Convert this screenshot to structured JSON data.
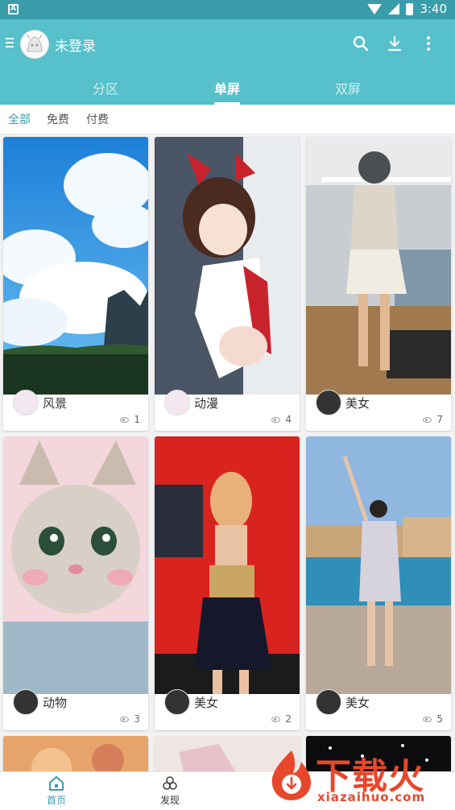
{
  "status_bar": {
    "time": "3:40"
  },
  "app_bar": {
    "title": "未登录",
    "icons": [
      "menu-icon",
      "search-icon",
      "download-icon",
      "more-vert-icon"
    ]
  },
  "tabs": [
    {
      "label": "分区",
      "active": false
    },
    {
      "label": "单屏",
      "active": true
    },
    {
      "label": "双屏",
      "active": false
    }
  ],
  "filters": [
    {
      "label": "全部",
      "active": true
    },
    {
      "label": "免费",
      "active": false
    },
    {
      "label": "付费",
      "active": false
    }
  ],
  "cards": [
    {
      "label": "风景",
      "views": "1"
    },
    {
      "label": "动漫",
      "views": "4"
    },
    {
      "label": "美女",
      "views": "7"
    },
    {
      "label": "动物",
      "views": "3"
    },
    {
      "label": "美女",
      "views": "2"
    },
    {
      "label": "美女",
      "views": "5"
    }
  ],
  "bottom_nav": [
    {
      "label": "首页",
      "active": true
    },
    {
      "label": "发现",
      "active": false
    }
  ],
  "watermark": {
    "text": "下载火",
    "url": "xiazaihuo.com"
  },
  "colors": {
    "primary": "#56c0cb",
    "primary_dark": "#3a9daa",
    "watermark": "#e8472c"
  }
}
